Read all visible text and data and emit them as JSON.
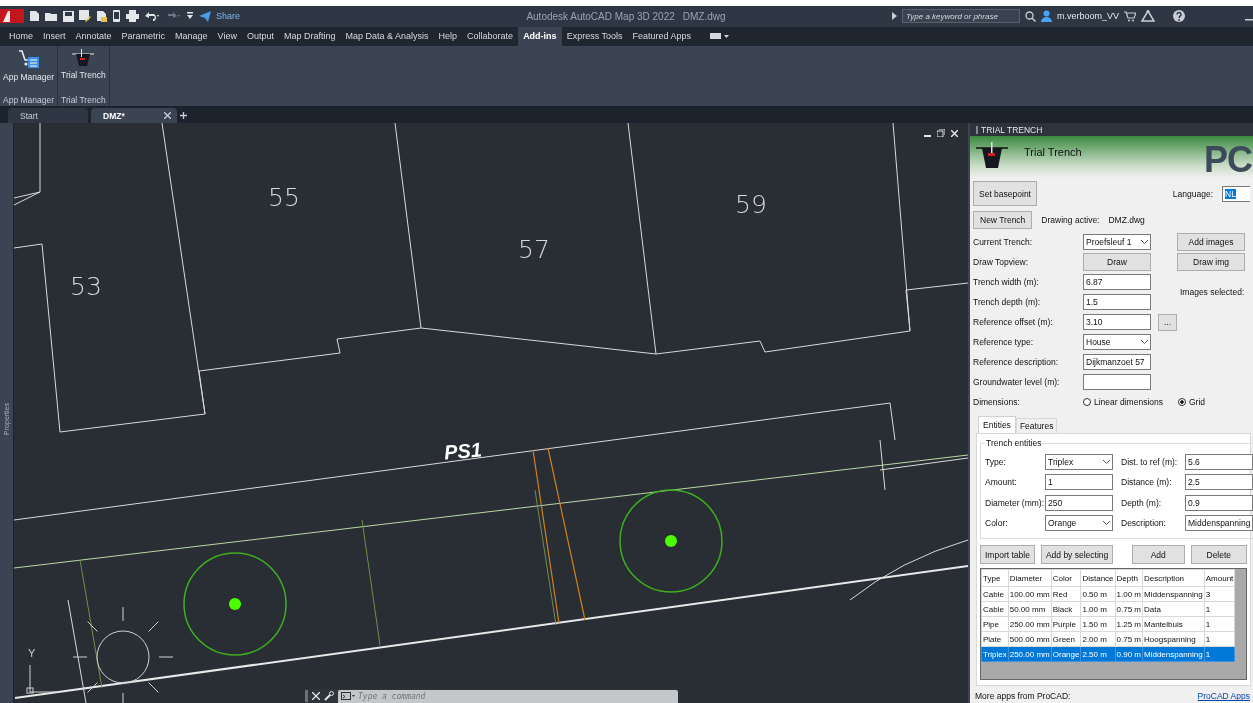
{
  "title_bar": {
    "share": "Share",
    "title": "Autodesk AutoCAD Map 3D 2022",
    "file": "DMZ.dwg",
    "search_placeholder": "Type a keyword or phrase",
    "user": "m.verboom_VV"
  },
  "ribbon_tabs": [
    {
      "label": "Home",
      "selected": false
    },
    {
      "label": "Insert",
      "selected": false
    },
    {
      "label": "Annotate",
      "selected": false
    },
    {
      "label": "Parametric",
      "selected": false
    },
    {
      "label": "Manage",
      "selected": false
    },
    {
      "label": "View",
      "selected": false
    },
    {
      "label": "Output",
      "selected": false
    },
    {
      "label": "Map Drafting",
      "selected": false
    },
    {
      "label": "Map Data & Analysis",
      "selected": false
    },
    {
      "label": "Help",
      "selected": false
    },
    {
      "label": "Collaborate",
      "selected": false
    },
    {
      "label": "Add-ins",
      "selected": true
    },
    {
      "label": "Express Tools",
      "selected": false
    },
    {
      "label": "Featured Apps",
      "selected": false
    }
  ],
  "ribbon": {
    "buttons": [
      {
        "label": "App Manager",
        "kind": "app-manager"
      },
      {
        "label": "Trial Trench",
        "kind": "trench"
      }
    ],
    "panels": [
      "App Manager",
      "Trial Trench"
    ]
  },
  "doc_tabs": [
    {
      "label": "Start",
      "selected": false
    },
    {
      "label": "DMZ*",
      "selected": true
    }
  ],
  "side_label": "Properties",
  "drawing": {
    "lot_numbers": [
      "53",
      "55",
      "57",
      "59"
    ],
    "trench_label": "PS1",
    "ucs_label": "Y"
  },
  "command_line": {
    "placeholder": "Type a command"
  },
  "panel": {
    "header": "TRIAL TRENCH",
    "brand_title": "Trial Trench",
    "brand_logo": "PC",
    "set_basepoint": "Set basepoint",
    "language_label": "Language:",
    "language": "NL",
    "new_trench": "New Trench",
    "drawing_active_label": "Drawing active:",
    "drawing_active": "DMZ.dwg",
    "fields": [
      {
        "label": "Current Trench:",
        "kind": "select",
        "value": "Proefsleuf 1"
      },
      {
        "label": "Draw Topview:",
        "kind": "button",
        "value": "Draw"
      },
      {
        "label": "Trench width (m):",
        "kind": "input",
        "value": "6.87"
      },
      {
        "label": "Trench depth (m):",
        "kind": "input",
        "value": "1.5"
      },
      {
        "label": "Reference offset (m):",
        "kind": "input",
        "value": "3.10",
        "extra_button": "..."
      },
      {
        "label": "Reference type:",
        "kind": "select",
        "value": "House"
      },
      {
        "label": "Reference description:",
        "kind": "input",
        "value": "Dijkmanzoet 57"
      },
      {
        "label": "Groundwater  level (m):",
        "kind": "input"
      }
    ],
    "add_images": "Add images",
    "draw_img": "Draw img",
    "images_selected": "Images selected:",
    "dimensions": {
      "label": "Dimensions:",
      "options": [
        {
          "label": "Linear dimensions",
          "selected": false
        },
        {
          "label": "Grid",
          "selected": true
        }
      ]
    },
    "sub_tabs": [
      {
        "label": "Entities",
        "selected": true
      },
      {
        "label": "Features",
        "selected": false
      }
    ],
    "group_title": "Trench entities",
    "entity_fields": [
      {
        "label": "Type:",
        "kind": "select",
        "value": "Triplex"
      },
      {
        "label": "Dist. to ref (m):",
        "kind": "input",
        "value": "5.6"
      },
      {
        "label": "Amount:",
        "kind": "input",
        "value": "1"
      },
      {
        "label": "Distance (m):",
        "kind": "input",
        "value": "2.5"
      },
      {
        "label": "Diameter (mm):",
        "kind": "input",
        "value": "250"
      },
      {
        "label": "Depth (m):",
        "kind": "input",
        "value": "0.9"
      },
      {
        "label": "Color:",
        "kind": "select",
        "value": "Orange"
      },
      {
        "label": "Description:",
        "kind": "input",
        "value": "Middenspanning"
      }
    ],
    "action_buttons": [
      "Import table",
      "Add by selecting",
      "Add",
      "Delete"
    ],
    "table": {
      "columns": [
        "Type",
        "Diameter",
        "Color",
        "Distance",
        "Depth",
        "Description",
        "Amount"
      ],
      "rows": [
        {
          "cells": [
            "Cable",
            "100.00 mm",
            "Red",
            "0.50 m",
            "1.00 m",
            "Middenspanning",
            "3"
          ],
          "selected": false
        },
        {
          "cells": [
            "Cable",
            "50.00 mm",
            "Black",
            "1.00 m",
            "0.75 m",
            "Data",
            "1"
          ],
          "selected": false
        },
        {
          "cells": [
            "Pipe",
            "250.00 mm",
            "Purple",
            "1.50 m",
            "1.25 m",
            "Mantelbuis",
            "1"
          ],
          "selected": false
        },
        {
          "cells": [
            "Plate",
            "500.00 mm",
            "Green",
            "2.00 m",
            "0.75 m",
            "Hoogspanning",
            "1"
          ],
          "selected": false
        },
        {
          "cells": [
            "Triplex",
            "250.00 mm",
            "Orange",
            "2.50 m",
            "0.90 m",
            "Middenspanning",
            "1"
          ],
          "selected": true
        }
      ]
    },
    "footer_text": "More apps from ProCAD:",
    "footer_link": "ProCAD Apps"
  }
}
